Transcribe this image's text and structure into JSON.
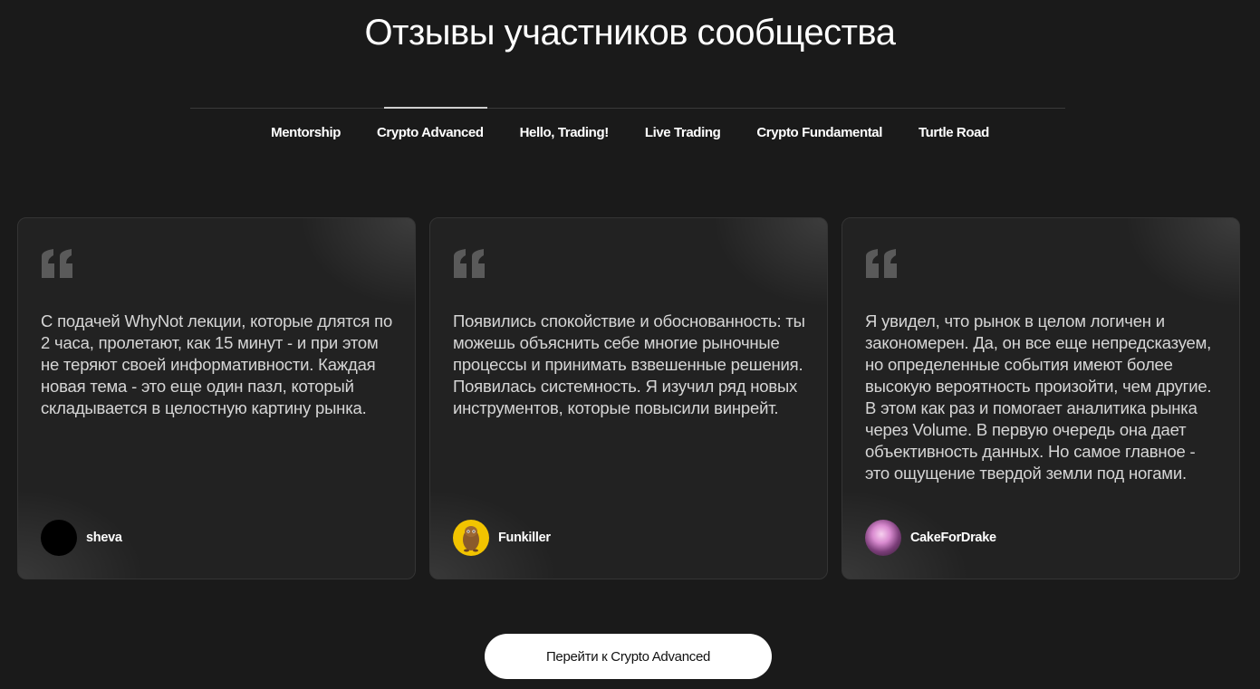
{
  "section": {
    "title": "Отзывы участников сообщества"
  },
  "tabs": [
    {
      "label": "Mentorship"
    },
    {
      "label": "Crypto Advanced",
      "active": true
    },
    {
      "label": "Hello, Trading!"
    },
    {
      "label": "Live Trading"
    },
    {
      "label": "Crypto Fundamental"
    },
    {
      "label": "Turtle Road"
    }
  ],
  "reviews": [
    {
      "text": "С подачей WhyNot лекции, которые длятся по 2 часа, пролетают, как 15 минут - и при этом не теряют своей информативности. Каждая новая тема - это еще один пазл, который складывается в целостную картину рынка.",
      "author": "sheva",
      "avatar_icon": "black-circle-avatar"
    },
    {
      "text": "Появились спокойствие и обоснованность: ты можешь объяснить себе многие рыночные процессы и принимать взвешенные решения. Появилась системность. Я изучил ряд новых инструментов, которые повысили винрейт.",
      "author": "Funkiller",
      "avatar_icon": "cartoon-creature-avatar"
    },
    {
      "text": "Я увидел, что рынок в целом логичен и закономерен. Да, он все еще непредсказуем, но определенные события имеют более высокую вероятность произойти, чем другие. В этом как раз и помогает аналитика рынка через Volume. В первую очередь она дает объективность данных. Но самое главное - это ощущение твердой земли под ногами.",
      "author": "CakeForDrake",
      "avatar_icon": "pink-photo-avatar"
    }
  ],
  "cta": {
    "label": "Перейти к Crypto Advanced"
  },
  "colors": {
    "background": "#1a1a1a",
    "card": "#222222",
    "quote_mark": "#5a5a5a",
    "text": "#d6d6d6",
    "button_bg": "#ffffff"
  }
}
